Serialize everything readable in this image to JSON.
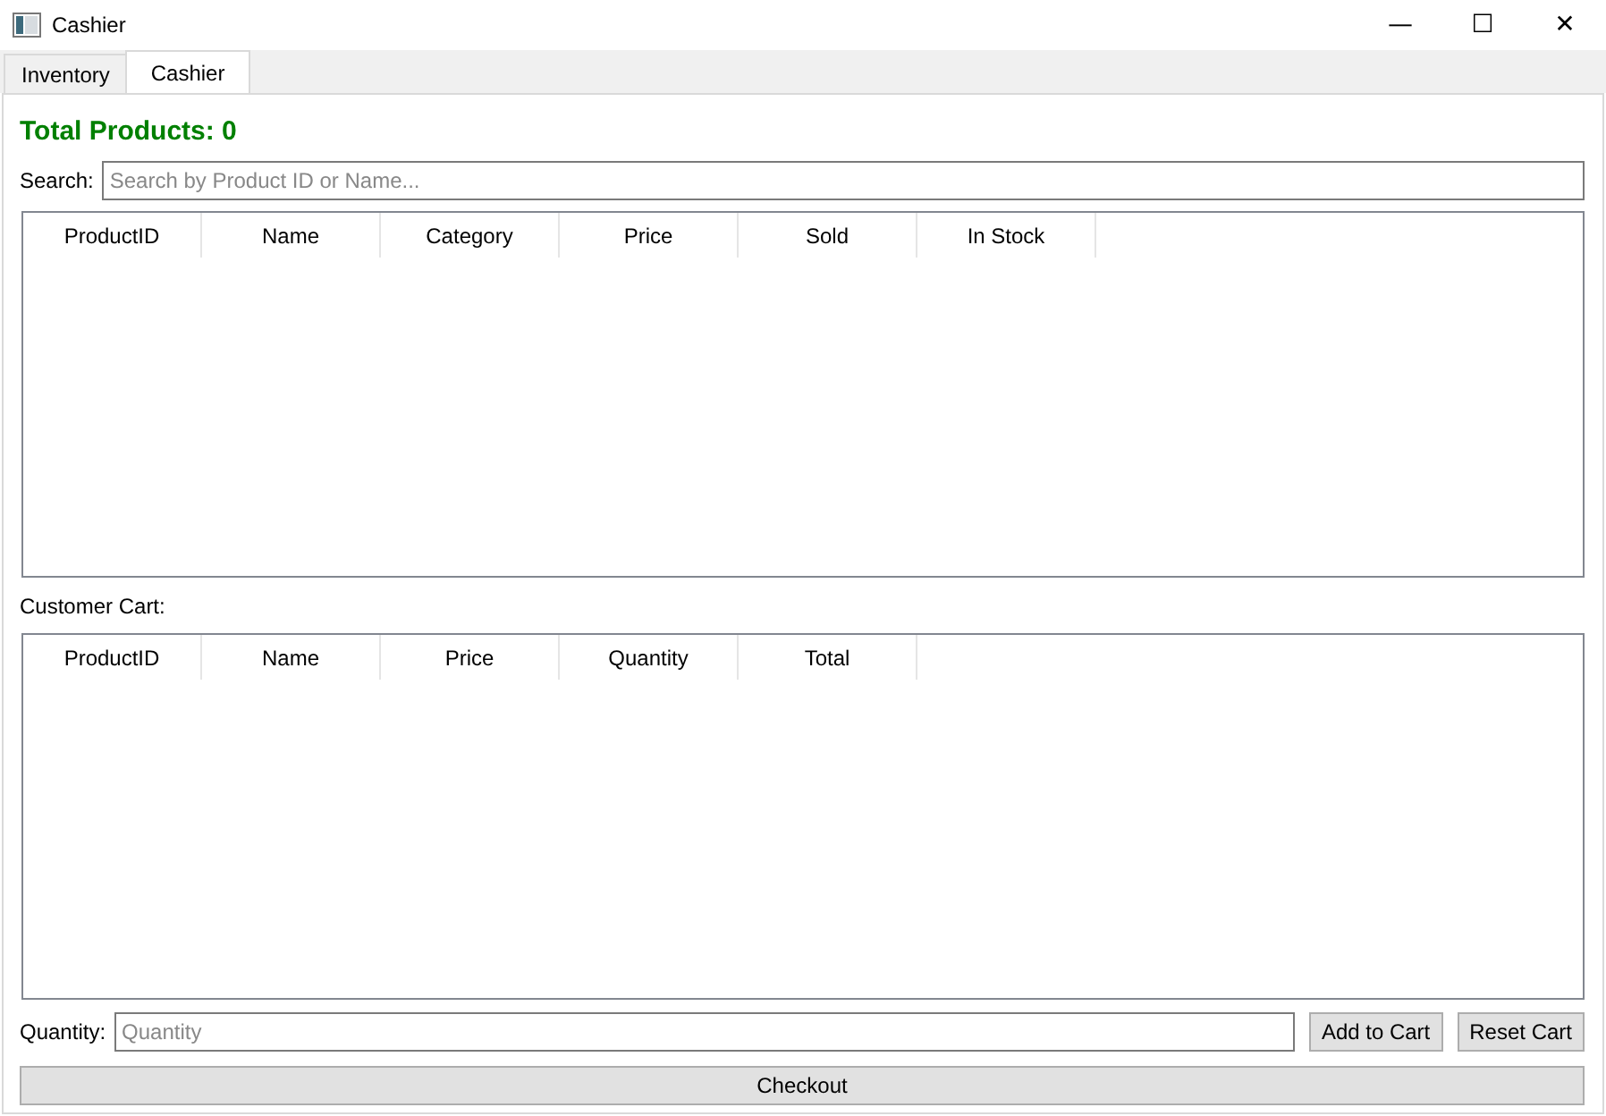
{
  "window": {
    "title": "Cashier",
    "controls": [
      "—",
      "☐",
      "✕"
    ]
  },
  "tabs": [
    {
      "label": "Inventory",
      "selected": false
    },
    {
      "label": "Cashier",
      "selected": true
    }
  ],
  "total_label": "Total Products: 0",
  "search": {
    "label": "Search:",
    "placeholder": "Search by Product ID or Name..."
  },
  "products_table": {
    "columns": [
      "ProductID",
      "Name",
      "Category",
      "Price",
      "Sold",
      "In Stock"
    ]
  },
  "cart_label": "Customer Cart:",
  "cart_table": {
    "columns": [
      "ProductID",
      "Name",
      "Price",
      "Quantity",
      "Total"
    ]
  },
  "quantity": {
    "label": "Quantity:",
    "placeholder": "Quantity"
  },
  "buttons": [
    "Add to Cart",
    "Reset Cart"
  ],
  "checkout": "Checkout"
}
